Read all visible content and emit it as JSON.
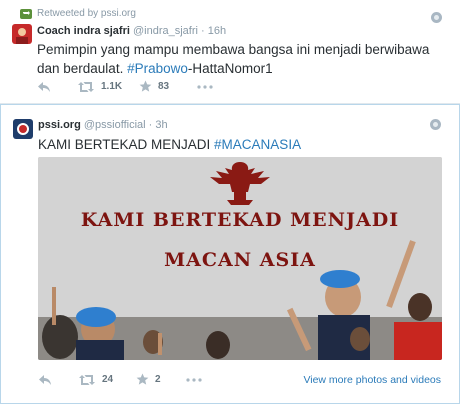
{
  "tweet1": {
    "retweet_context": "Retweeted by pssi.org",
    "name": "Coach indra sjafri",
    "handle": "@indra_sjafri",
    "time": "16h",
    "text_part1": "Pemimpin yang mampu membawa bangsa ini menjadi berwibawa dan berdaulat. ",
    "hashtag": "#Prabowo",
    "text_part2": "-HattaNomor1",
    "retweets": "1.1K",
    "favorites": "83"
  },
  "tweet2": {
    "name": "pssi.org",
    "handle": "@pssiofficial",
    "time": "3h",
    "text_part1": "KAMI BERTEKAD MENJADI ",
    "hashtag": "#MACANASIA",
    "image_line1": "KAMI BERTEKAD MENJADI",
    "image_line2": "MACAN ASIA",
    "retweets": "24",
    "favorites": "2",
    "view_more": "View more photos and videos"
  },
  "icons": {
    "reply": "reply-icon",
    "retweet": "retweet-icon",
    "favorite": "star-icon",
    "more": "more-icon",
    "globe": "globe-icon"
  },
  "colors": {
    "link": "#2b7bb9",
    "meta": "#8899a6",
    "banner_text": "#7d1410",
    "retweet_green": "#5c913b"
  }
}
